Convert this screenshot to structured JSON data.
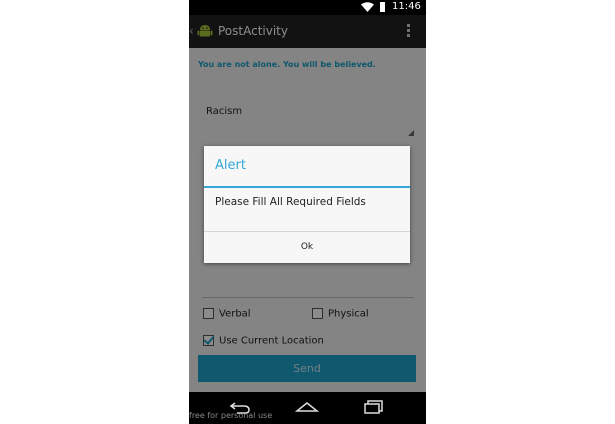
{
  "status_bar": {
    "time": "11:46",
    "icons": [
      "wifi-icon",
      "battery-icon"
    ]
  },
  "action_bar": {
    "title": "PostActivity",
    "icons": [
      "back-chevron-icon",
      "android-app-icon",
      "overflow-menu-icon"
    ]
  },
  "form": {
    "tagline": "You are not alone. You will be believed.",
    "category_spinner_value": "Racism",
    "checkboxes": [
      {
        "label": "Verbal",
        "checked": false
      },
      {
        "label": "Physical",
        "checked": false
      },
      {
        "label": "Use Current Location",
        "checked": true
      }
    ],
    "send_label": "Send"
  },
  "dialog": {
    "title": "Alert",
    "message": "Please Fill All Required Fields",
    "ok_label": "Ok"
  },
  "nav_bar": {
    "icons": [
      "back-icon",
      "home-icon",
      "recent-apps-icon"
    ]
  },
  "watermark": "free for personal use",
  "colors": {
    "accent": "#33a8d8",
    "button": "#1ea0c8"
  }
}
